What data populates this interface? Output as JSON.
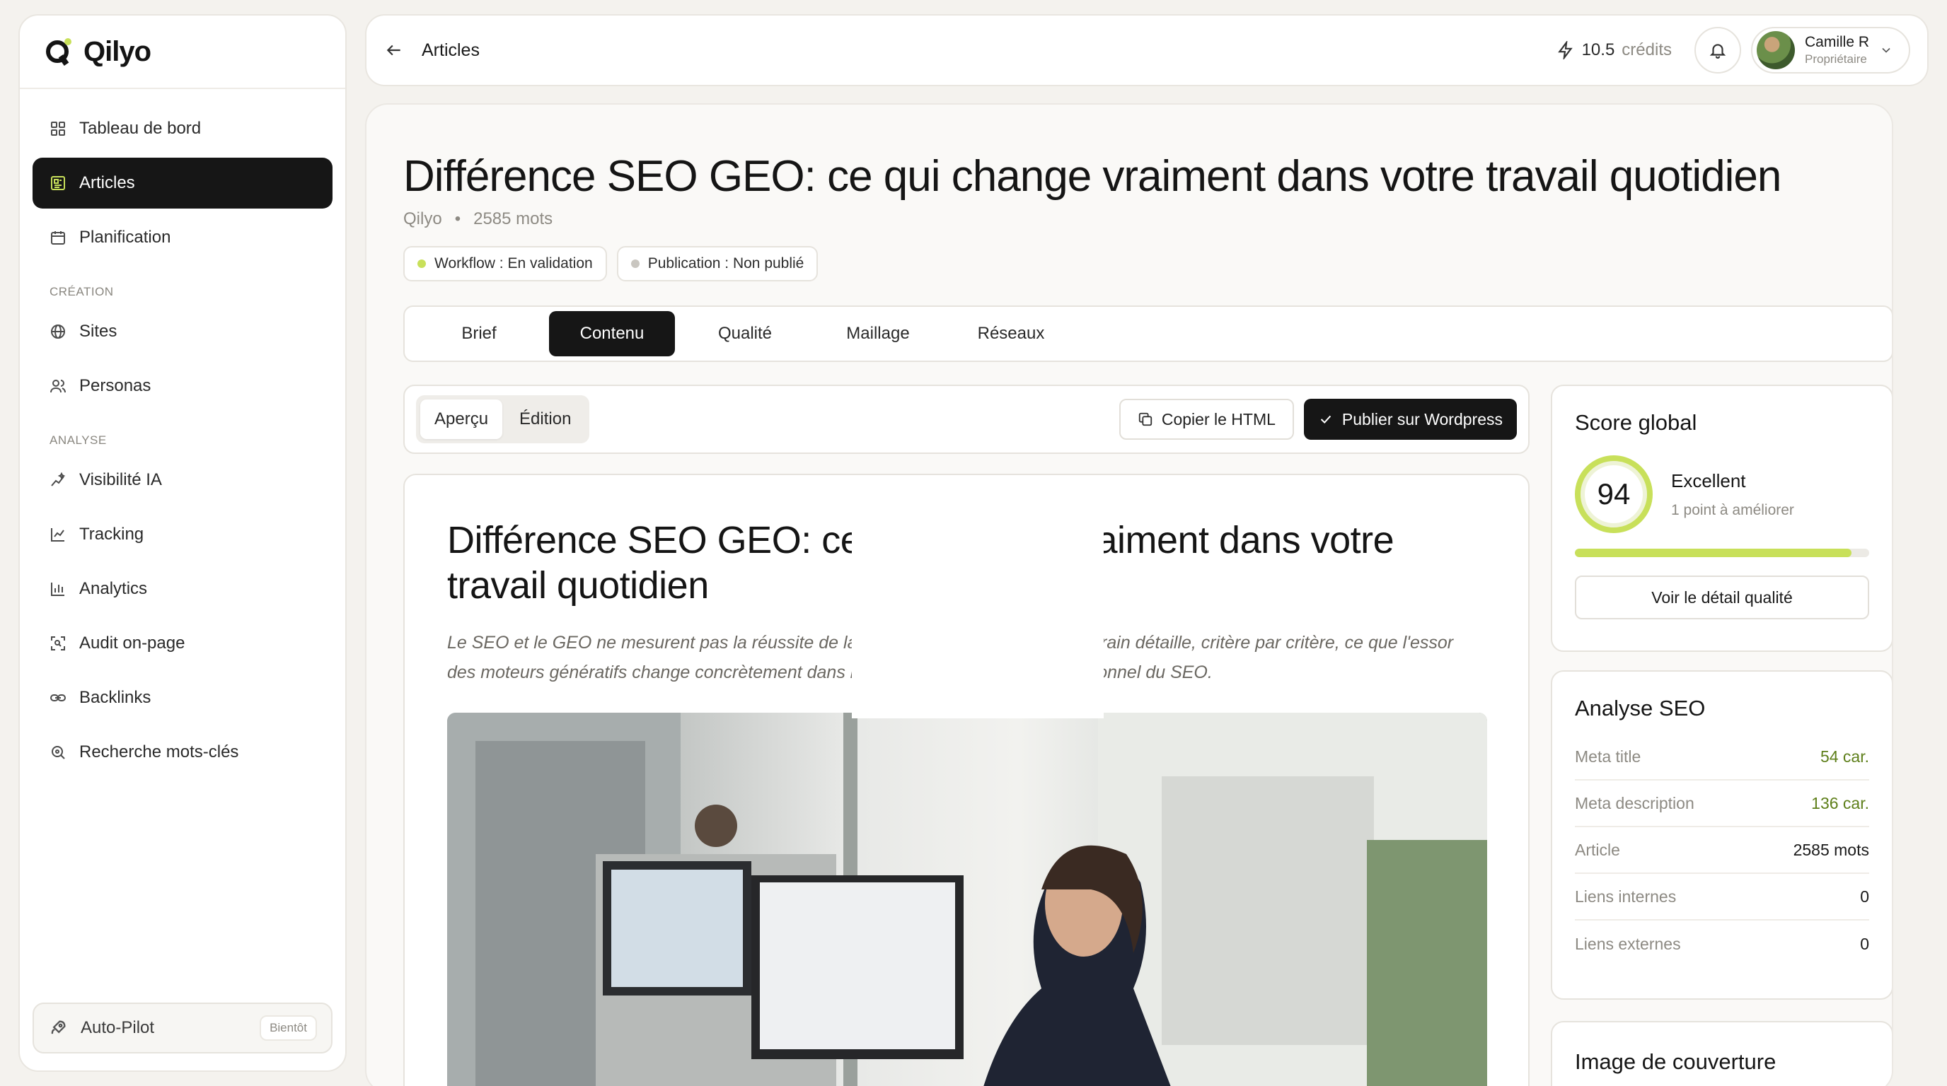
{
  "app": {
    "name": "Qilyo",
    "accent": "#c8e05a"
  },
  "sidebar": {
    "items_top": [
      {
        "label": "Tableau de bord",
        "icon": "dashboard-icon"
      },
      {
        "label": "Articles",
        "icon": "articles-icon",
        "active": true
      },
      {
        "label": "Planification",
        "icon": "calendar-icon"
      }
    ],
    "section_creation": "CRÉATION",
    "items_creation": [
      {
        "label": "Sites",
        "icon": "globe-icon"
      },
      {
        "label": "Personas",
        "icon": "users-icon"
      }
    ],
    "section_analyse": "ANALYSE",
    "items_analyse": [
      {
        "label": "Visibilité IA",
        "icon": "sparkle-icon"
      },
      {
        "label": "Tracking",
        "icon": "line-chart-icon"
      },
      {
        "label": "Analytics",
        "icon": "bar-chart-icon"
      },
      {
        "label": "Audit on-page",
        "icon": "scan-icon"
      },
      {
        "label": "Backlinks",
        "icon": "link-icon"
      },
      {
        "label": "Recherche mots-clés",
        "icon": "search-icon"
      }
    ],
    "autopilot": {
      "label": "Auto-Pilot",
      "badge": "Bientôt"
    }
  },
  "topbar": {
    "back_label": "Articles",
    "credits_value": "10.5",
    "credits_unit": "crédits",
    "user": {
      "name": "Camille R",
      "role": "Propriétaire"
    }
  },
  "article": {
    "title": "Différence SEO GEO: ce qui change vraiment dans votre travail quotidien",
    "site": "Qilyo",
    "separator": "•",
    "words": "2585 mots",
    "workflow_chip": "Workflow : En validation",
    "publication_chip": "Publication : Non publié",
    "tabs": [
      "Brief",
      "Contenu",
      "Qualité",
      "Maillage",
      "Réseaux"
    ],
    "active_tab": "Contenu",
    "view_modes": [
      "Aperçu",
      "Édition"
    ],
    "copy_html": "Copier le HTML",
    "publish": "Publier sur Wordpress",
    "preview_title": "Différence SEO GEO: ce qui change vraiment dans votre travail quotidien",
    "preview_lead": "Le SEO et le GEO ne mesurent pas la réussite de la même façon. ce comparatif terrain détaille, critère par critère, ce que l'essor des moteurs génératifs change concrètement dans la travail quotidien d'un professionnel du SEO."
  },
  "score": {
    "title": "Score global",
    "value": "94",
    "label": "Excellent",
    "sub": "1 point à améliorer",
    "progress": 0.94,
    "button": "Voir le détail qualité"
  },
  "seo": {
    "title": "Analyse SEO",
    "rows": [
      {
        "label": "Meta title",
        "value": "54 car."
      },
      {
        "label": "Meta description",
        "value": "136 car."
      },
      {
        "label": "Article",
        "value": "2585 mots"
      },
      {
        "label": "Liens internes",
        "value": "0"
      },
      {
        "label": "Liens externes",
        "value": "0"
      }
    ]
  },
  "cover_card": {
    "title": "Image de couverture"
  },
  "colors": {
    "workflow_dot": "#c8e05a",
    "publication_dot": "#c9c6c0",
    "dark": "#161616"
  }
}
